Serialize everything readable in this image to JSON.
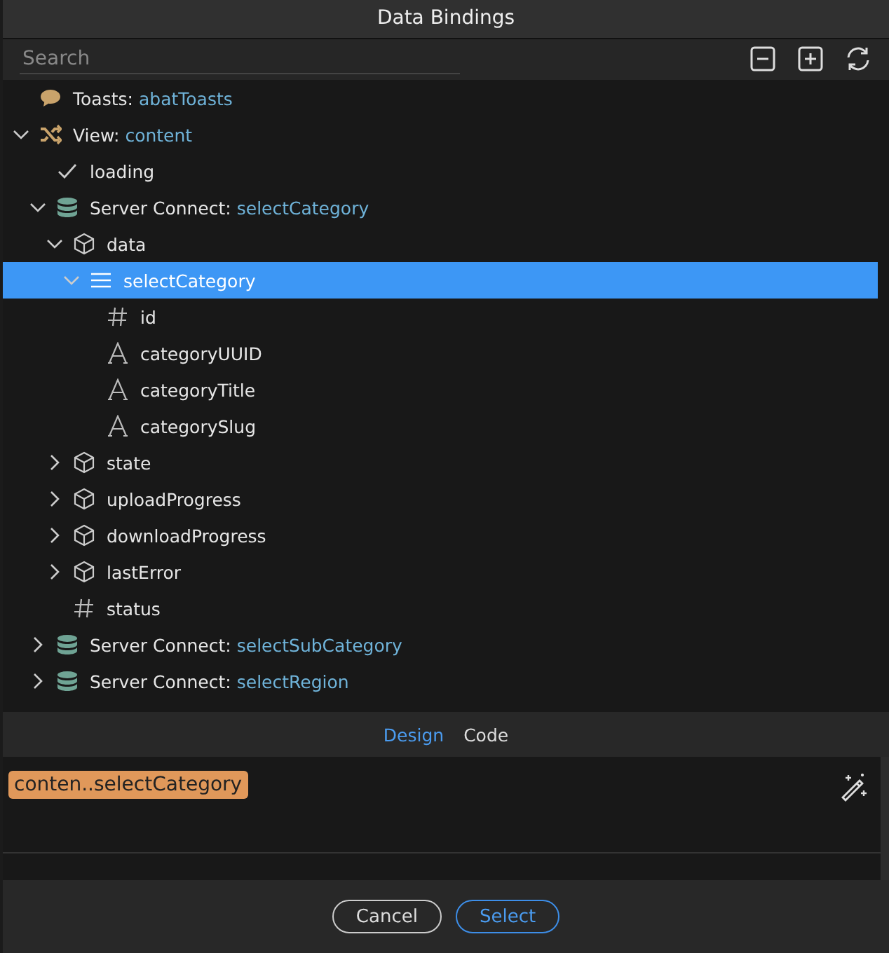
{
  "window": {
    "title": "Data Bindings"
  },
  "search": {
    "placeholder": "Search"
  },
  "tree": [
    {
      "kind": "toasts",
      "label": "Toasts:",
      "value": "abatToasts",
      "selected": false
    },
    {
      "kind": "view",
      "label": "View:",
      "value": "content",
      "expanded": true,
      "selected": false,
      "children": [
        {
          "kind": "check",
          "label": "loading",
          "selected": false
        },
        {
          "kind": "server",
          "label": "Server Connect:",
          "value": "selectCategory",
          "expanded": true,
          "selected": false,
          "children": [
            {
              "kind": "object",
              "label": "data",
              "expanded": true,
              "selected": false,
              "children": [
                {
                  "kind": "array",
                  "label": "selectCategory",
                  "expanded": true,
                  "selected": true,
                  "children": [
                    {
                      "kind": "number",
                      "label": "id",
                      "selected": false
                    },
                    {
                      "kind": "text",
                      "label": "categoryUUID",
                      "selected": false
                    },
                    {
                      "kind": "text",
                      "label": "categoryTitle",
                      "selected": false
                    },
                    {
                      "kind": "text",
                      "label": "categorySlug",
                      "selected": false
                    }
                  ]
                }
              ]
            },
            {
              "kind": "object",
              "label": "state",
              "expanded": false,
              "selected": false
            },
            {
              "kind": "object",
              "label": "uploadProgress",
              "expanded": false,
              "selected": false
            },
            {
              "kind": "object",
              "label": "downloadProgress",
              "expanded": false,
              "selected": false
            },
            {
              "kind": "object",
              "label": "lastError",
              "expanded": false,
              "selected": false
            },
            {
              "kind": "number",
              "label": "status",
              "selected": false
            }
          ]
        },
        {
          "kind": "server",
          "label": "Server Connect:",
          "value": "selectSubCategory",
          "expanded": false,
          "selected": false
        },
        {
          "kind": "server",
          "label": "Server Connect:",
          "value": "selectRegion",
          "expanded": false,
          "selected": false
        }
      ]
    }
  ],
  "tabs": [
    {
      "label": "Design",
      "selected": true
    },
    {
      "label": "Code",
      "selected": false
    }
  ],
  "editor": {
    "token": "conten..selectCategory"
  },
  "buttons": [
    {
      "label": "Cancel",
      "kind": "secondary"
    },
    {
      "label": "Select",
      "kind": "primary"
    }
  ]
}
